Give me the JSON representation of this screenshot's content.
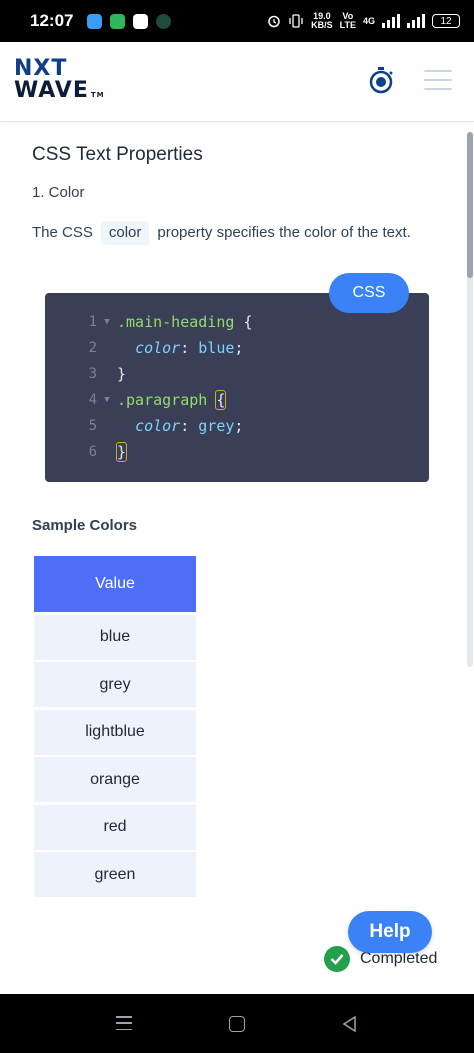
{
  "status_bar": {
    "time": "12:07",
    "speed_value": "19.0",
    "speed_unit": "KB/S",
    "volte_top": "Vo",
    "volte_bottom": "LTE",
    "net_type": "4G",
    "battery": "12"
  },
  "header": {
    "logo_line1": "NXT",
    "logo_line2": "WAVE",
    "logo_tm": "TM"
  },
  "page": {
    "title": "CSS Text Properties",
    "section_heading": "1. Color",
    "desc_before": "The CSS",
    "desc_code": "color",
    "desc_after": "property specifies the color of the text."
  },
  "code_editor": {
    "language_badge": "CSS",
    "line_numbers": [
      "1",
      "2",
      "3",
      "4",
      "5",
      "6"
    ],
    "selector1": ".main-heading",
    "selector2": ".paragraph",
    "open_brace": "{",
    "close_brace": "}",
    "prop1": "color",
    "value1": "blue",
    "prop2": "color",
    "value2": "grey",
    "colon": ":",
    "semicolon": ";"
  },
  "sample_colors": {
    "heading": "Sample Colors",
    "column_header": "Value",
    "values": [
      "blue",
      "grey",
      "lightblue",
      "orange",
      "red",
      "green"
    ]
  },
  "help_label": "Help",
  "completed_label": "Completed",
  "colors": {
    "accent": "#3b82f6",
    "table_header": "#4f6ef7",
    "table_row": "#eef2fb",
    "editor_bg": "#3a3e56",
    "completed_check": "#22a04b"
  }
}
